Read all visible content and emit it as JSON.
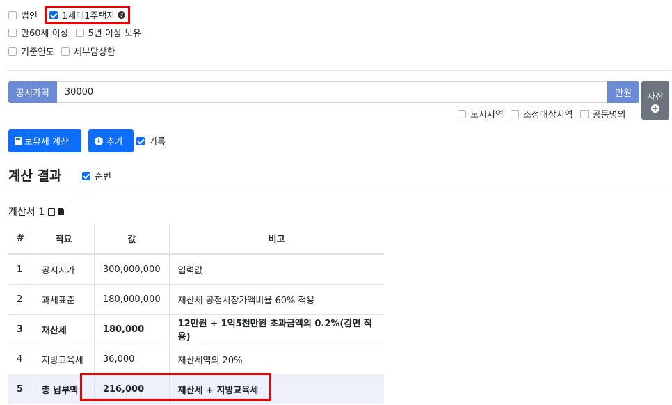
{
  "options": {
    "row1": [
      {
        "label": "법인",
        "checked": false
      },
      {
        "label": "1세대1주택자",
        "checked": true,
        "help_icon": "question-circle-icon"
      }
    ],
    "row2": [
      {
        "label": "만60세 이상",
        "checked": false
      },
      {
        "label": "5년 이상 보유",
        "checked": false
      }
    ],
    "row3": [
      {
        "label": "기준연도",
        "checked": false
      },
      {
        "label": "세부담상한",
        "checked": false
      }
    ]
  },
  "price_input": {
    "prefix": "공시가격",
    "value": "30000",
    "suffix": "만원"
  },
  "asset_button": {
    "label": "자산",
    "icon": "plus-circle-icon"
  },
  "region_options": [
    {
      "label": "도시지역",
      "checked": false
    },
    {
      "label": "조정대상지역",
      "checked": false
    },
    {
      "label": "공동명의",
      "checked": false
    }
  ],
  "actions": {
    "calc_label": "보유세 계산",
    "add_label": "추가",
    "record_label": "기록",
    "record_checked": true
  },
  "result": {
    "title": "계산 결과",
    "order_label": "순번",
    "order_checked": true,
    "sheet_title": "계산서 1",
    "columns": [
      "#",
      "적요",
      "값",
      "비고"
    ],
    "rows": [
      {
        "no": "1",
        "item": "공시지가",
        "value": "300,000,000",
        "note": "입력값"
      },
      {
        "no": "2",
        "item": "과세표준",
        "value": "180,000,000",
        "note": "재산세 공정시장가액비율 60% 적용"
      },
      {
        "no": "3",
        "item": "재산세",
        "value": "180,000",
        "note": "12만원 + 1억5천만원 초과금액의 0.2%(감면 적용)"
      },
      {
        "no": "4",
        "item": "지방교육세",
        "value": "36,000",
        "note": "재산세액의 20%"
      },
      {
        "no": "5",
        "item": "총 납부액",
        "value": "216,000",
        "note": "재산세 + 지방교육세"
      }
    ]
  },
  "colors": {
    "primary": "#0d6efd",
    "addon": "#6c8bd6",
    "highlight_border": "#e00000"
  }
}
